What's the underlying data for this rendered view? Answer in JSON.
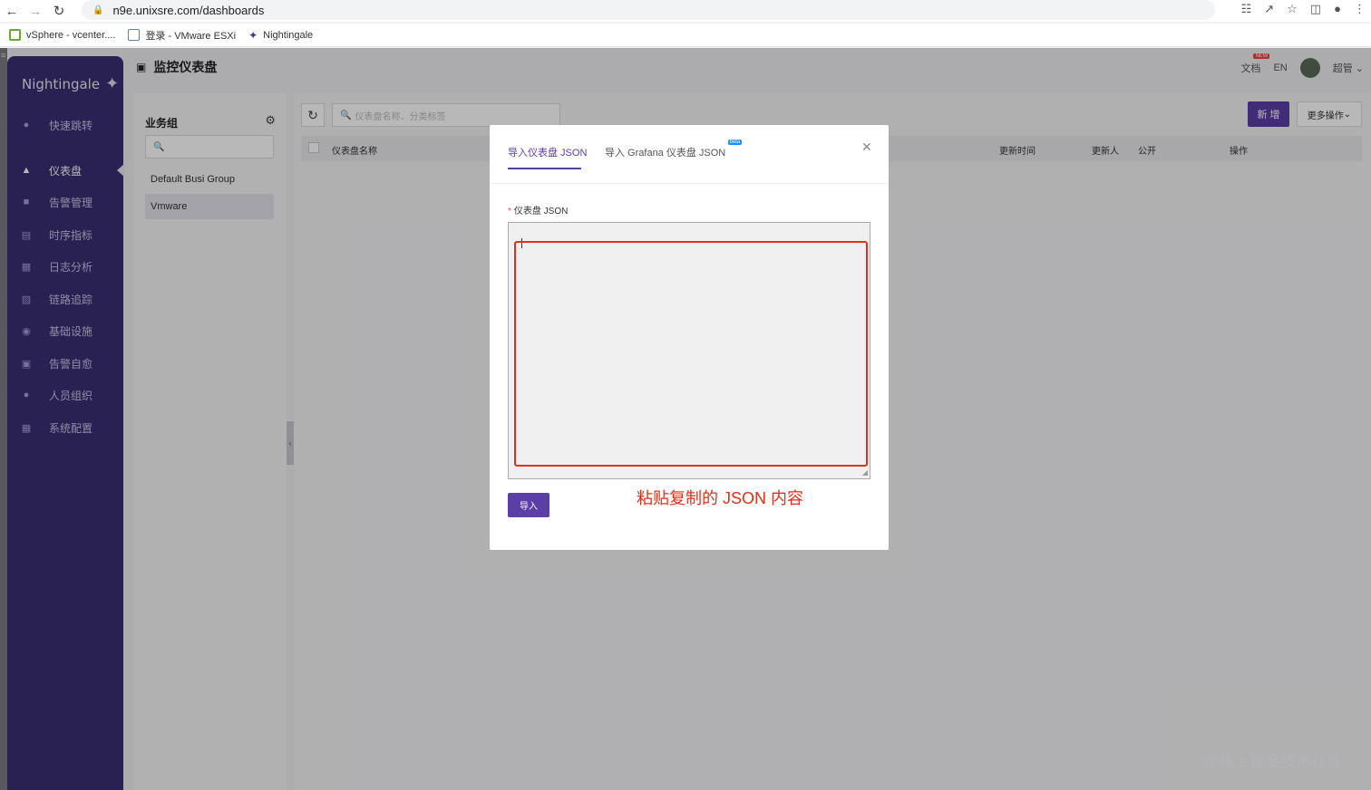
{
  "browser": {
    "url": "n9e.unixsre.com/dashboards",
    "bookmarks": [
      {
        "label": "vSphere - vcenter...."
      },
      {
        "label": "登录 - VMware ESXi"
      },
      {
        "label": "Nightingale"
      }
    ]
  },
  "app": {
    "logo_text": "Nightingale",
    "page_title": "监控仪表盘",
    "header": {
      "docs": "文档",
      "new_badge": "NEW",
      "lang": "EN",
      "user": "超管"
    }
  },
  "sidebar": {
    "items": [
      {
        "label": "快速跳转",
        "icon": "dot-icon"
      },
      {
        "label": "仪表盘",
        "icon": "dashboard-icon",
        "active": true
      },
      {
        "label": "告警管理",
        "icon": "alarm-icon"
      },
      {
        "label": "时序指标",
        "icon": "chart-icon"
      },
      {
        "label": "日志分析",
        "icon": "log-icon"
      },
      {
        "label": "链路追踪",
        "icon": "trace-icon"
      },
      {
        "label": "基础设施",
        "icon": "infra-icon"
      },
      {
        "label": "告警自愈",
        "icon": "heal-icon"
      },
      {
        "label": "人员组织",
        "icon": "user-icon"
      },
      {
        "label": "系统配置",
        "icon": "settings-icon"
      }
    ]
  },
  "groups": {
    "title": "业务组",
    "items": [
      "Default Busi Group",
      "Vmware"
    ],
    "selected": "Vmware"
  },
  "toolbar": {
    "search_placeholder": "仪表盘名称、分类标签",
    "new_label": "新 增",
    "more_label": "更多操作"
  },
  "table": {
    "columns": [
      "仪表盘名称",
      "更新时间",
      "更新人",
      "公开",
      "操作"
    ]
  },
  "modal": {
    "tabs": [
      "导入仪表盘 JSON",
      "导入 Grafana 仪表盘 JSON"
    ],
    "beta_badge": "beta",
    "active_tab": 0,
    "field_label": "仪表盘 JSON",
    "required_mark": "*",
    "json_value": "",
    "import_label": "导入",
    "annotation": "粘贴复制的 JSON 内容"
  },
  "watermark": "@稀土掘金技术社区",
  "colors": {
    "sidebar": "#3b2f74",
    "primary": "#5b3ea6",
    "annotation_red": "#e1301a"
  }
}
